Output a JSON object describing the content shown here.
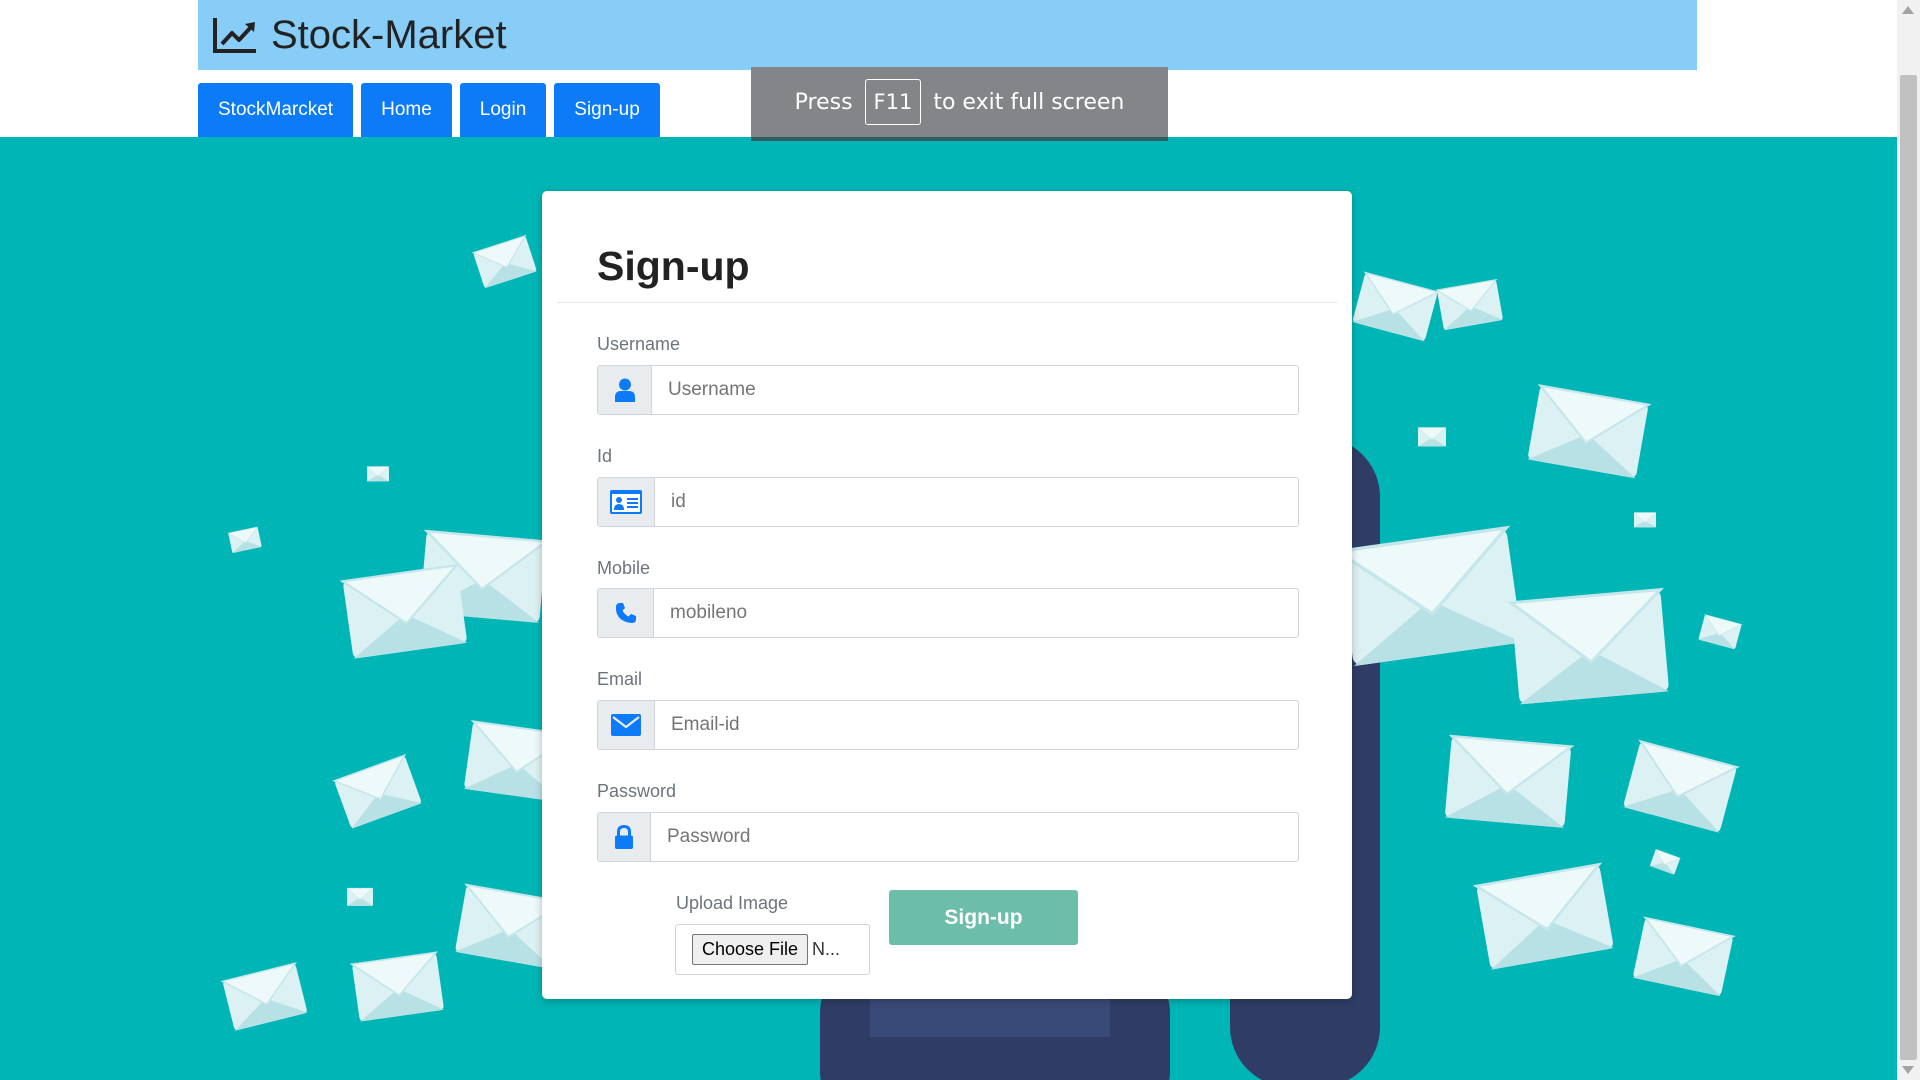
{
  "brand": {
    "title": "Stock-Market",
    "icon": "line-chart-icon"
  },
  "nav": [
    "StockMarcket",
    "Home",
    "Login",
    "Sign-up"
  ],
  "fullscreen_toast": {
    "before": "Press",
    "key": "F11",
    "after": "to exit full screen"
  },
  "form": {
    "title": "Sign-up",
    "fields": [
      {
        "label": "Username",
        "placeholder": "Username",
        "icon": "user-icon"
      },
      {
        "label": "Id",
        "placeholder": "id",
        "icon": "id-card-icon"
      },
      {
        "label": "Mobile",
        "placeholder": "mobileno",
        "icon": "phone-icon"
      },
      {
        "label": "Email",
        "placeholder": "Email-id",
        "icon": "envelope-icon"
      },
      {
        "label": "Password",
        "placeholder": "Password",
        "icon": "lock-icon"
      }
    ],
    "upload_label": "Upload Image",
    "choose_file": "Choose File",
    "file_status": "N...",
    "submit": "Sign-up"
  },
  "colors": {
    "header": "#87cdf7",
    "nav_button": "#0d7bf7",
    "background": "#00b5b5",
    "submit_button": "#6cbdaa",
    "icon_blue": "#0d7bf7"
  }
}
